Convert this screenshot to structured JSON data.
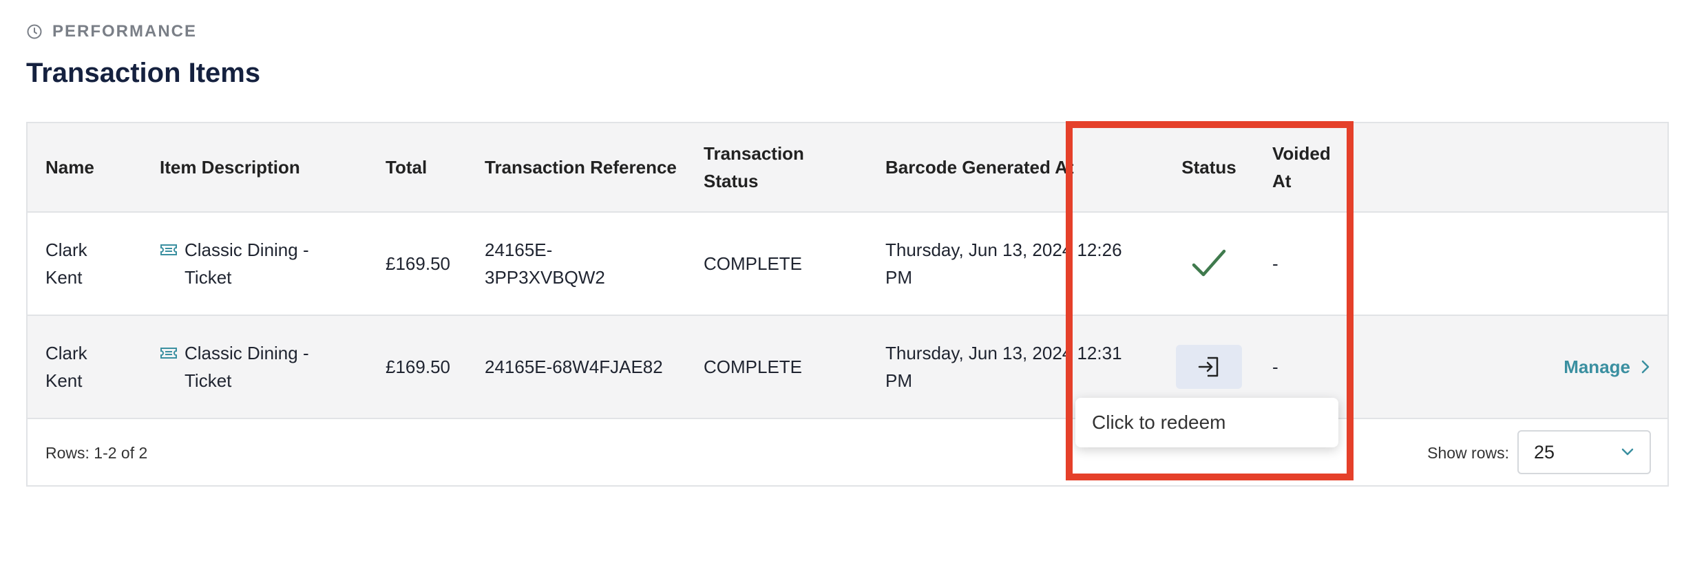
{
  "section": {
    "label": "PERFORMANCE",
    "icon": "clock-icon"
  },
  "title": "Transaction Items",
  "table": {
    "headers": {
      "name": "Name",
      "description": "Item Description",
      "total": "Total",
      "reference": "Transaction Reference",
      "transaction_status_line1": "Transaction",
      "transaction_status_line2": "Status",
      "barcode": "Barcode Generated At",
      "status": "Status",
      "voided_line1": "Voided",
      "voided_line2": "At"
    },
    "rows": [
      {
        "name_line1": "Clark",
        "name_line2": "Kent",
        "desc_line1": "Classic Dining -",
        "desc_line2": "Ticket",
        "total": "£169.50",
        "ref_line1": "24165E-",
        "ref_line2": "3PP3XVBQW2",
        "transaction_status": "COMPLETE",
        "barcode_line1": "Thursday, Jun 13, 2024 12:26",
        "barcode_line2": "PM",
        "status_icon": "checkmark-icon",
        "voided_at": "-"
      },
      {
        "name_line1": "Clark",
        "name_line2": "Kent",
        "desc_line1": "Classic Dining -",
        "desc_line2": "Ticket",
        "total": "£169.50",
        "reference": "24165E-68W4FJAE82",
        "transaction_status": "COMPLETE",
        "barcode_line1": "Thursday, Jun 13, 2024 12:31",
        "barcode_line2": "PM",
        "status_icon": "redeem-icon",
        "voided_at": "-",
        "action": "Manage"
      }
    ],
    "footer": {
      "rows_info": "Rows: 1-2 of 2",
      "show_rows_label": "Show rows:",
      "show_rows_value": "25"
    }
  },
  "tooltip": "Click to redeem",
  "colors": {
    "title": "#15213f",
    "accent_teal": "#3a8fa0",
    "check_green": "#3f7a4d",
    "highlight_red": "#e5402a",
    "redeem_bg": "#e3e8f3"
  }
}
